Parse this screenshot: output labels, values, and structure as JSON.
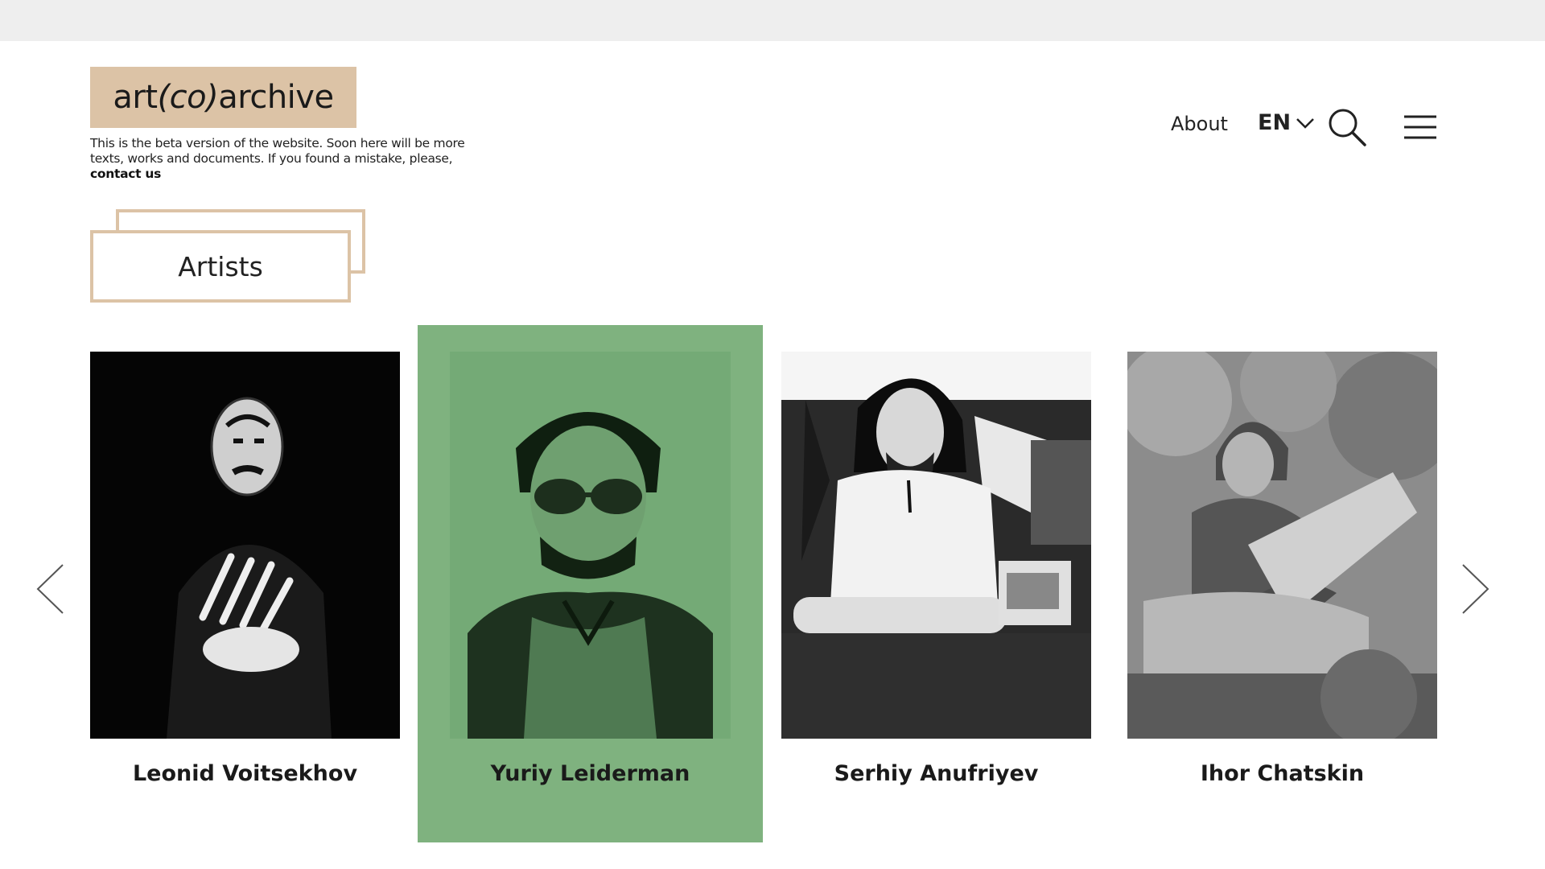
{
  "header": {
    "logo": {
      "part1": "art",
      "part2": "(co)",
      "part3": "archive"
    },
    "beta_note": "This is the beta version of the website. Soon here will be more texts, works and documents. If you found a mistake, please,",
    "contact_link": "contact us"
  },
  "nav": {
    "about": "About",
    "language": "EN",
    "icons": [
      "chevron-down-icon",
      "search-icon",
      "hamburger-menu-icon"
    ]
  },
  "section": {
    "title": "Artists"
  },
  "artists": [
    {
      "name": "Leonid Voitsekhov",
      "active": false
    },
    {
      "name": "Yuriy Leiderman",
      "active": true
    },
    {
      "name": "Serhiy Anufriyev",
      "active": false
    },
    {
      "name": "Ihor Chatskin",
      "active": false
    }
  ],
  "colors": {
    "accent_beige": "#dcc3a6",
    "active_green": "#7fb27f",
    "browser_strip": "#eeeeee"
  },
  "carousel": {
    "prev_icon": "chevron-left-icon",
    "next_icon": "chevron-right-icon"
  }
}
